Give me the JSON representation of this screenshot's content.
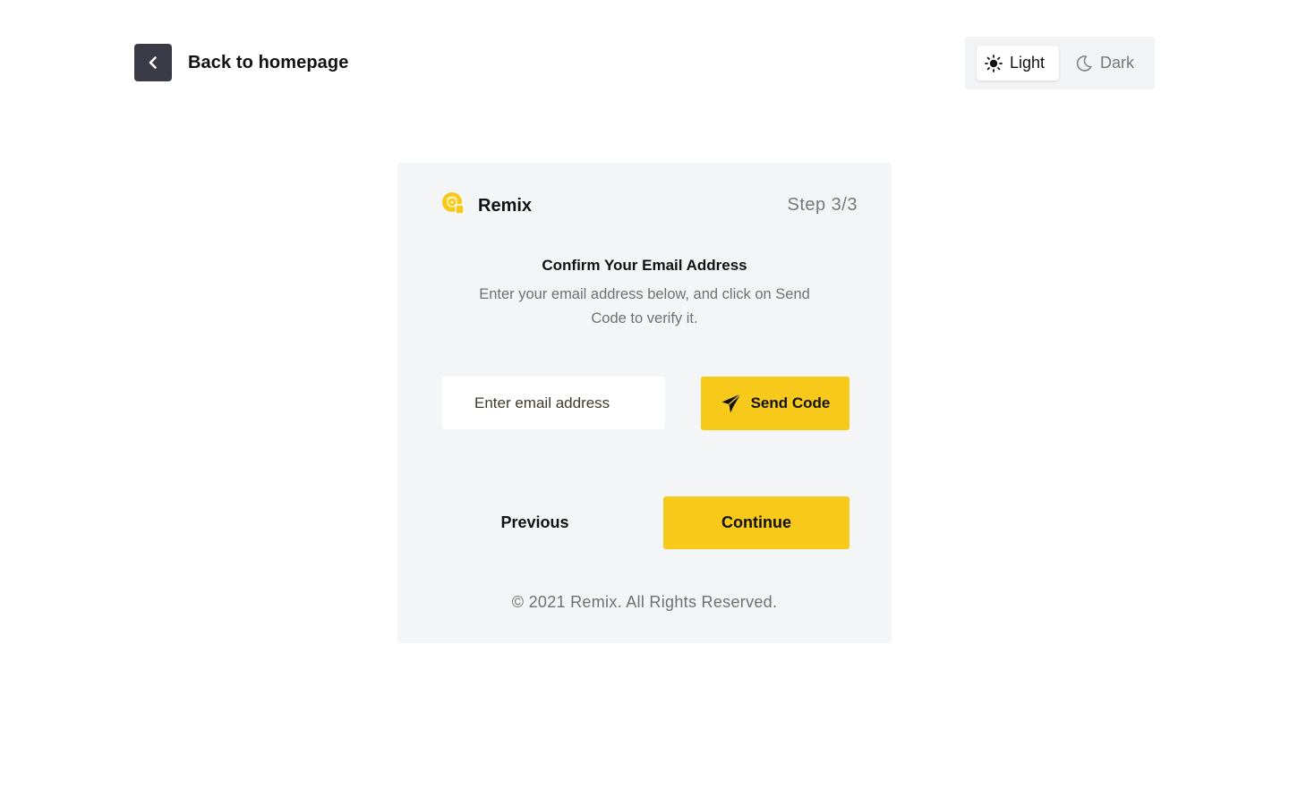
{
  "header": {
    "back_label": "Back to homepage",
    "back_icon": "chevron-left-icon"
  },
  "theme": {
    "light_label": "Light",
    "dark_label": "Dark",
    "selected": "Light",
    "light_icon": "sun-icon",
    "dark_icon": "moon-icon"
  },
  "card": {
    "brand_name": "Remix",
    "brand_icon": "remix-logo-icon",
    "step": "Step 3/3",
    "title": "Confirm Your Email Address",
    "subtitle": "Enter your email address below, and click on Send Code to verify it.",
    "email": {
      "placeholder": "Enter email address",
      "value": ""
    },
    "send_code_label": "Send Code",
    "send_icon": "paper-plane-icon",
    "previous_label": "Previous",
    "continue_label": "Continue",
    "footer": "© 2021 Remix. All Rights Reserved."
  },
  "colors": {
    "accent": "#f7c91a",
    "back_button_bg": "#3b3b47",
    "card_bg": "#f4f5f6",
    "muted_text": "#707070"
  }
}
